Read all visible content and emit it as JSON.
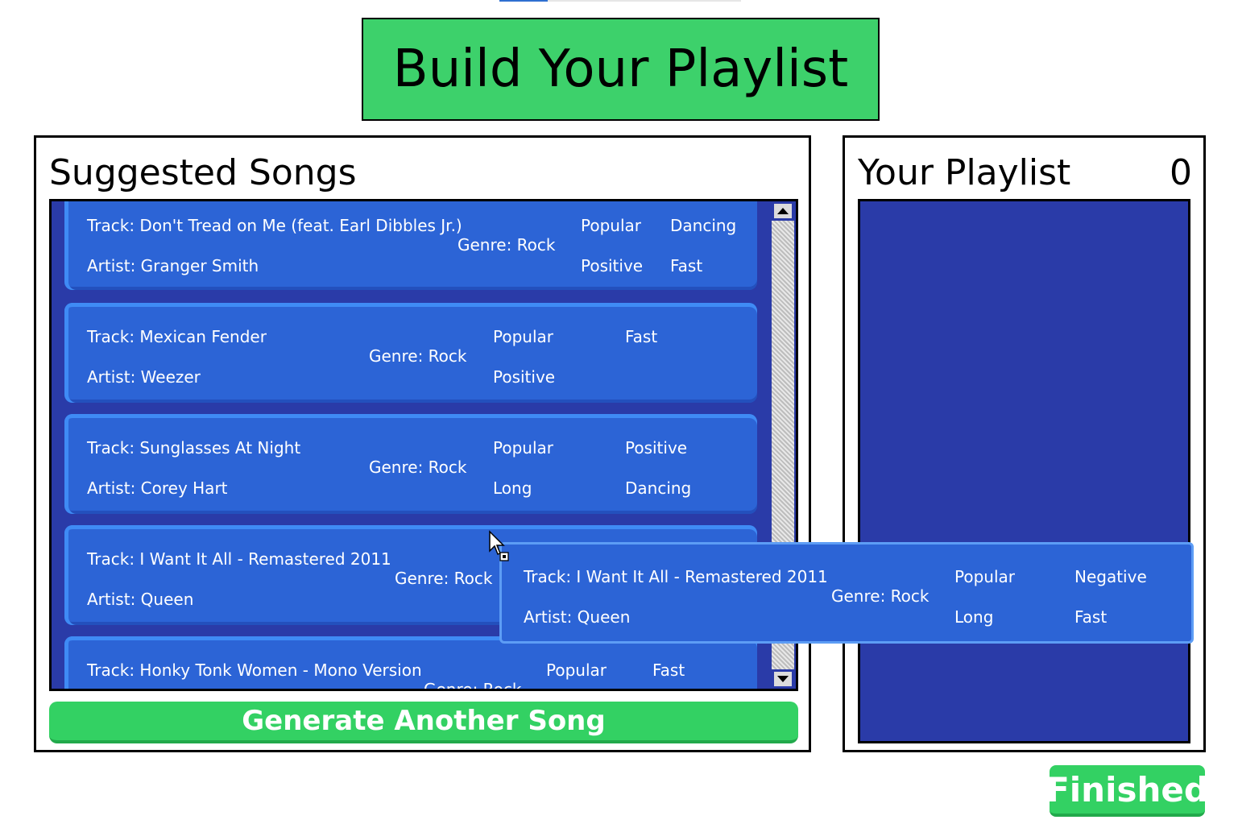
{
  "app": {
    "title": "Build Your Playlist"
  },
  "suggested": {
    "heading": "Suggested Songs",
    "songs": [
      {
        "track": "Track: Don't Tread on Me (feat. Earl Dibbles Jr.)",
        "artist": "Artist: Granger Smith",
        "genre": "Genre: Rock",
        "tags": [
          "Popular",
          "Dancing",
          "Positive",
          "Fast"
        ]
      },
      {
        "track": "Track: Mexican Fender",
        "artist": "Artist: Weezer",
        "genre": "Genre: Rock",
        "tags": [
          "Popular",
          "Fast",
          "Positive",
          ""
        ]
      },
      {
        "track": "Track: Sunglasses At Night",
        "artist": "Artist: Corey Hart",
        "genre": "Genre: Rock",
        "tags": [
          "Popular",
          "Positive",
          "Long",
          "Dancing"
        ]
      },
      {
        "track": "Track: I Want It All - Remastered 2011",
        "artist": "Artist: Queen",
        "genre": "Genre: Rock",
        "tags": [
          "",
          "",
          "",
          ""
        ]
      },
      {
        "track": "Track: Honky Tonk Women - Mono Version",
        "artist": "",
        "genre": "Genre: Rock",
        "tags": [
          "Popular",
          "Fast",
          "",
          ""
        ]
      }
    ],
    "generate_label": "Generate Another Song"
  },
  "playlist": {
    "heading": "Your Playlist",
    "count": "0"
  },
  "dragging": {
    "track": "Track: I Want It All - Remastered 2011",
    "artist": "Artist: Queen",
    "genre": "Genre: Rock",
    "tags": [
      "Popular",
      "Negative",
      "Long",
      "Fast"
    ]
  },
  "finished_label": "Finished",
  "icons": {
    "scroll_up": "scroll-up-arrow-icon",
    "scroll_down": "scroll-down-arrow-icon",
    "cursor": "mouse-pointer-icon"
  },
  "colors": {
    "title_green": "#3dd16b",
    "list_navy": "#2a3ba8",
    "card_blue": "#2c64d6"
  }
}
